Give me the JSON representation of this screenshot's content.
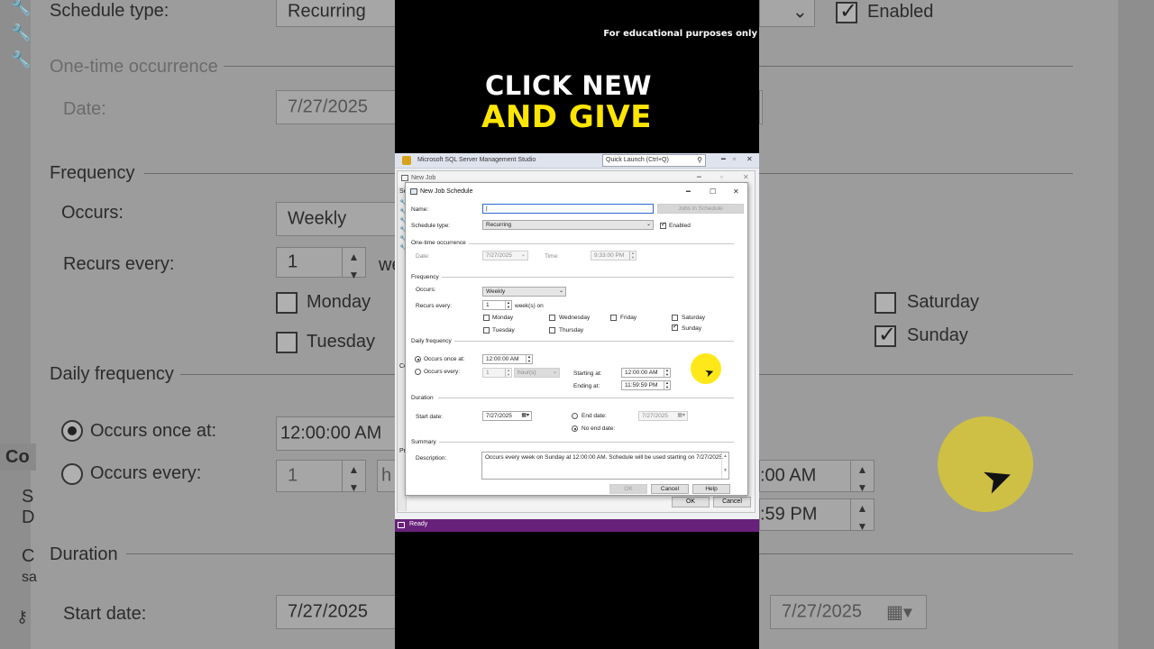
{
  "overlay": {
    "disclaimer": "For educational purposes only",
    "caption_line1": "CLICK NEW",
    "caption_line2": "AND GIVE"
  },
  "background": {
    "schedule_type_label": "Schedule type:",
    "schedule_type_value": "Recurring",
    "enabled_label": "Enabled",
    "one_time_label": "One-time occurrence",
    "date_label": "Date:",
    "date_value": "7/27/2025",
    "frequency_label": "Frequency",
    "occurs_label": "Occurs:",
    "occurs_value": "Weekly",
    "recurs_label": "Recurs every:",
    "recurs_value": "1",
    "recurs_unit_partial": "we",
    "monday": "Monday",
    "tuesday": "Tuesday",
    "saturday": "Saturday",
    "sunday": "Sunday",
    "daily_label": "Daily frequency",
    "occurs_once_label": "Occurs once at:",
    "occurs_once_value": "12:00:00 AM",
    "occurs_every_label": "Occurs every:",
    "occurs_every_value": "1",
    "occurs_every_unit_partial": "h",
    "right_time1_partial": ":00 AM",
    "right_time2_partial": ":59 PM",
    "duration_label": "Duration",
    "start_date_label": "Start date:",
    "start_date_value": "7/27/2025",
    "end_date_value": "7/27/2025",
    "left_frag_co": "Co",
    "left_frag_s": "S",
    "left_frag_d": "D",
    "left_frag_c": "C",
    "left_frag_sa": "sa"
  },
  "ssms": {
    "title": "Microsoft SQL Server Management Studio",
    "quick_launch_placeholder": "Quick Launch (Ctrl+Q)",
    "status": "Ready"
  },
  "new_job": {
    "title": "New Job",
    "ok": "OK",
    "cancel": "Cancel",
    "side_se": "Se",
    "side_co": "Co",
    "side_pr": "Pr"
  },
  "schedule_dialog": {
    "title": "New Job Schedule",
    "name_label": "Name:",
    "name_value": "",
    "jobs_in_schedule": "Jobs in Schedule",
    "schedule_type_label": "Schedule type:",
    "schedule_type_value": "Recurring",
    "enabled_label": "Enabled",
    "enabled": true,
    "one_time": {
      "section": "One-time occurrence",
      "date_label": "Date:",
      "date_value": "7/27/2025",
      "time_label": "Time:",
      "time_value": "9:33:00 PM"
    },
    "frequency": {
      "section": "Frequency",
      "occurs_label": "Occurs:",
      "occurs_value": "Weekly",
      "recurs_label": "Recurs every:",
      "recurs_value": "1",
      "recurs_unit": "week(s) on",
      "days": {
        "monday": "Monday",
        "tuesday": "Tuesday",
        "wednesday": "Wednesday",
        "thursday": "Thursday",
        "friday": "Friday",
        "saturday": "Saturday",
        "sunday": "Sunday"
      },
      "sunday_checked": true
    },
    "daily": {
      "section": "Daily frequency",
      "once_label": "Occurs once at:",
      "once_value": "12:00:00 AM",
      "every_label": "Occurs every:",
      "every_value": "1",
      "every_unit": "hour(s)",
      "starting_label": "Starting at:",
      "starting_value": "12:00:00 AM",
      "ending_label": "Ending at:",
      "ending_value": "11:59:59 PM"
    },
    "duration": {
      "section": "Duration",
      "start_label": "Start date:",
      "start_value": "7/27/2025",
      "end_label": "End date:",
      "end_value": "7/27/2025",
      "no_end_label": "No end date:"
    },
    "summary": {
      "section": "Summary",
      "desc_label": "Description:",
      "desc_value": "Occurs every week on Sunday at 12:00:00 AM. Schedule will be used starting on 7/27/2025."
    },
    "buttons": {
      "ok": "OK",
      "cancel": "Cancel",
      "help": "Help"
    }
  },
  "colors": {
    "accent_yellow": "#ffe600",
    "ssms_purple": "#68217a"
  }
}
